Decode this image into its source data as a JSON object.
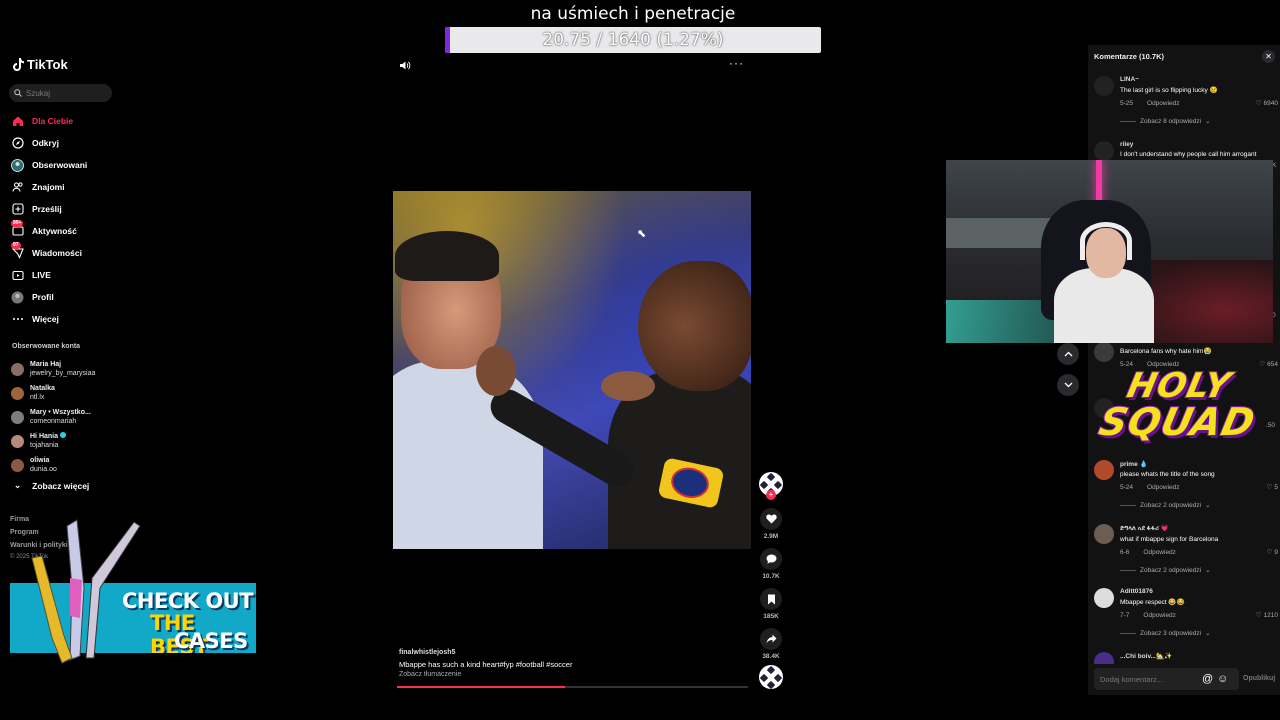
{
  "stream_overlay": {
    "title": "na uśmiech i penetracje",
    "progress_text": "20.75 / 1640 (1.27%)",
    "progress_fraction": 0.0127
  },
  "sidebar": {
    "logo": "TikTok",
    "search_placeholder": "Szukaj",
    "nav": [
      {
        "label": "Dla Ciebie",
        "icon": "home-icon",
        "active": true
      },
      {
        "label": "Odkryj",
        "icon": "compass-icon"
      },
      {
        "label": "Obserwowani",
        "icon": "following-avatar-icon"
      },
      {
        "label": "Znajomi",
        "icon": "friends-icon"
      },
      {
        "label": "Prześlij",
        "icon": "upload-icon"
      },
      {
        "label": "Aktywność",
        "icon": "inbox-icon",
        "badge": "99+"
      },
      {
        "label": "Wiadomości",
        "icon": "messages-icon",
        "badge": "97"
      },
      {
        "label": "LIVE",
        "icon": "live-icon"
      },
      {
        "label": "Profil",
        "icon": "profile-icon"
      },
      {
        "label": "Więcej",
        "icon": "more-icon"
      }
    ],
    "followed_title": "Obserwowane konta",
    "followed": [
      {
        "name": "Maria Haj",
        "handle": "jewelry_by_marysiaa"
      },
      {
        "name": "Natalka",
        "handle": "ntl.lx"
      },
      {
        "name": "Mary • Wszystko...",
        "handle": "comeonmariah"
      },
      {
        "name": "Hi Hania",
        "handle": "tojahania"
      },
      {
        "name": "oliwia",
        "handle": "dunia.oo"
      }
    ],
    "see_more": "Zobacz więcej",
    "footer": [
      "Firma",
      "Program",
      "Warunki i polityki"
    ],
    "copyright": "© 2025 TikTok"
  },
  "ad_banner": {
    "line1": "CHECK OUT",
    "line2": "THE BEST",
    "line3": "CASES"
  },
  "video": {
    "author": "finalwhistlejosh5",
    "caption": "Mbappe has such a kind heart#fyp  #football  #soccer",
    "translate": "Zobacz tłumaczenie",
    "likes": "2.9M",
    "comments": "10.7K",
    "saves": "185K",
    "shares": "38.4K",
    "progress_fraction": 0.48
  },
  "comments_panel": {
    "header": "Komentarze (10.7K)",
    "input_placeholder": "Dodaj komentarz...",
    "post_label": "Opublikuj",
    "items": [
      {
        "user": "LINA~",
        "text": "The last girl is so flipping lucky 😢",
        "date": "5-25",
        "reply": "Odpowiedz",
        "likes": "6940",
        "replies": "Zobacz 8 odpowiedzi"
      },
      {
        "user": "riley",
        "text": "I don't understand why people call him arrogant"
      },
      {
        "user": "",
        "text": "Barcelona fans why hate him😭",
        "date": "5-24",
        "reply": "Odpowiedz",
        "likes": "654"
      },
      {
        "user": "prime 💧",
        "text": "please whats the title of the song",
        "date": "5-24",
        "reply": "Odpowiedz",
        "likes": "5",
        "replies": "Zobacz 2 odpowiedzi"
      },
      {
        "user": "ድግላለ አደ ፋፋሪ 💗",
        "text": "what if mbappe sign for Barcelona",
        "date": "6-6",
        "reply": "Odpowiedz",
        "likes": "9",
        "replies": "Zobacz 2 odpowiedzi"
      },
      {
        "user": "Aditt01876",
        "text": "Mbappe respect 😂😂",
        "date": "7-7",
        "reply": "Odpowiedz",
        "likes": "1210",
        "replies": "Zobacz 3 odpowiedzi"
      },
      {
        "user": "...Chi boiv...🏡✨",
        "text": ""
      }
    ],
    "partial_likes": [
      ".50",
      "0",
      "K"
    ]
  },
  "holy_squad": {
    "line1": "HOLY",
    "line2": "SQUAD"
  },
  "colors": {
    "accent": "#fe2c55",
    "progress": "#7a2be0"
  }
}
